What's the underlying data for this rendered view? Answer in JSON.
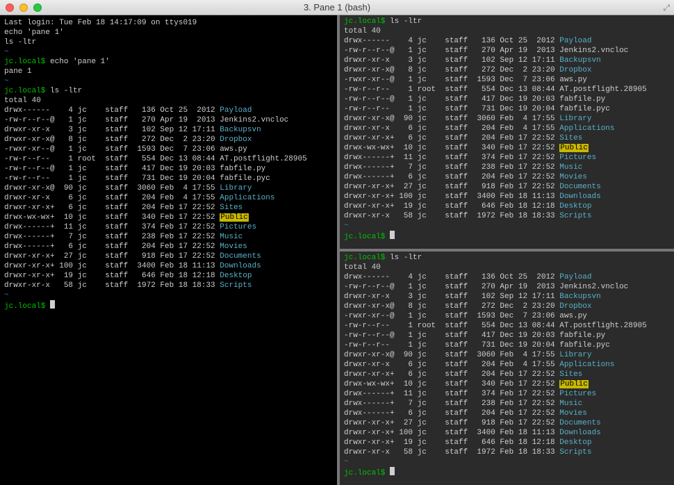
{
  "window": {
    "title": "3. Pane 1 (bash)"
  },
  "left": {
    "header": [
      "Last login: Tue Feb 18 14:17:09 on ttys019",
      "echo 'pane 1'",
      "ls -ltr"
    ],
    "prompt_host": "jc.local$",
    "cmds": [
      {
        "cmd": "echo 'pane 1'",
        "out": [
          "pane 1"
        ]
      }
    ],
    "ls_cmd": "ls -ltr",
    "total": "total 40",
    "rows": [
      {
        "perm": "drwx------ ",
        "links": "  4",
        "user": "jc  ",
        "group": "staff",
        "size": "  136",
        "date": "Oct 25  2012",
        "name": "Payload",
        "style": "fblue"
      },
      {
        "perm": "-rw-r--r--@",
        "links": "  1",
        "user": "jc  ",
        "group": "staff",
        "size": "  270",
        "date": "Apr 19  2013",
        "name": "Jenkins2.vncloc",
        "style": "fname"
      },
      {
        "perm": "drwxr-xr-x ",
        "links": "  3",
        "user": "jc  ",
        "group": "staff",
        "size": "  102",
        "date": "Sep 12 17:11",
        "name": "Backupsvn",
        "style": "fblue"
      },
      {
        "perm": "drwxr-xr-x@",
        "links": "  8",
        "user": "jc  ",
        "group": "staff",
        "size": "  272",
        "date": "Dec  2 23:20",
        "name": "Dropbox",
        "style": "fblue"
      },
      {
        "perm": "-rwxr-xr--@",
        "links": "  1",
        "user": "jc  ",
        "group": "staff",
        "size": " 1593",
        "date": "Dec  7 23:06",
        "name": "aws.py",
        "style": "fname"
      },
      {
        "perm": "-rw-r--r-- ",
        "links": "  1",
        "user": "root",
        "group": "staff",
        "size": "  554",
        "date": "Dec 13 08:44",
        "name": "AT.postflight.28905",
        "style": "fname"
      },
      {
        "perm": "-rw-r--r--@",
        "links": "  1",
        "user": "jc  ",
        "group": "staff",
        "size": "  417",
        "date": "Dec 19 20:03",
        "name": "fabfile.py",
        "style": "fname"
      },
      {
        "perm": "-rw-r--r-- ",
        "links": "  1",
        "user": "jc  ",
        "group": "staff",
        "size": "  731",
        "date": "Dec 19 20:04",
        "name": "fabfile.pyc",
        "style": "fname"
      },
      {
        "perm": "drwxr-xr-x@",
        "links": " 90",
        "user": "jc  ",
        "group": "staff",
        "size": " 3060",
        "date": "Feb  4 17:55",
        "name": "Library",
        "style": "fblue"
      },
      {
        "perm": "drwxr-xr-x ",
        "links": "  6",
        "user": "jc  ",
        "group": "staff",
        "size": "  204",
        "date": "Feb  4 17:55",
        "name": "Applications",
        "style": "fblue"
      },
      {
        "perm": "drwxr-xr-x+",
        "links": "  6",
        "user": "jc  ",
        "group": "staff",
        "size": "  204",
        "date": "Feb 17 22:52",
        "name": "Sites",
        "style": "fblue"
      },
      {
        "perm": "drwx-wx-wx+",
        "links": " 10",
        "user": "jc  ",
        "group": "staff",
        "size": "  340",
        "date": "Feb 17 22:52",
        "name": "Public",
        "style": "hl-yel"
      },
      {
        "perm": "drwx------+",
        "links": " 11",
        "user": "jc  ",
        "group": "staff",
        "size": "  374",
        "date": "Feb 17 22:52",
        "name": "Pictures",
        "style": "fblue"
      },
      {
        "perm": "drwx------+",
        "links": "  7",
        "user": "jc  ",
        "group": "staff",
        "size": "  238",
        "date": "Feb 17 22:52",
        "name": "Music",
        "style": "fblue"
      },
      {
        "perm": "drwx------+",
        "links": "  6",
        "user": "jc  ",
        "group": "staff",
        "size": "  204",
        "date": "Feb 17 22:52",
        "name": "Movies",
        "style": "fblue"
      },
      {
        "perm": "drwxr-xr-x+",
        "links": " 27",
        "user": "jc  ",
        "group": "staff",
        "size": "  918",
        "date": "Feb 17 22:52",
        "name": "Documents",
        "style": "fblue"
      },
      {
        "perm": "drwxr-xr-x+",
        "links": "100",
        "user": "jc  ",
        "group": "staff",
        "size": " 3400",
        "date": "Feb 18 11:13",
        "name": "Downloads",
        "style": "fblue"
      },
      {
        "perm": "drwxr-xr-x+",
        "links": " 19",
        "user": "jc  ",
        "group": "staff",
        "size": "  646",
        "date": "Feb 18 12:18",
        "name": "Desktop",
        "style": "fblue"
      },
      {
        "perm": "drwxr-xr-x ",
        "links": " 58",
        "user": "jc  ",
        "group": "staff",
        "size": " 1972",
        "date": "Feb 18 18:33",
        "name": "Scripts",
        "style": "fblue"
      }
    ]
  },
  "right": {
    "prompt_host": "jc.local$",
    "ls_cmd": "ls -ltr",
    "total": "total 40"
  }
}
